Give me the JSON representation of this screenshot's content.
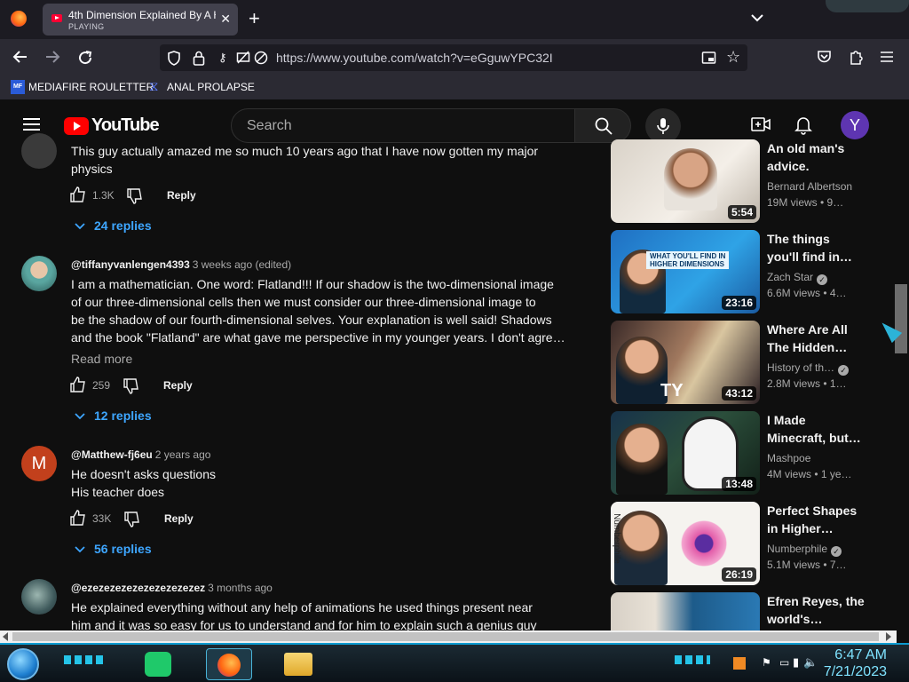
{
  "browser": {
    "tab": {
      "title": "4th Dimension Explained By A Hig",
      "status": "PLAYING",
      "close": "✕"
    },
    "new_tab": "+",
    "tab_list": "⌄",
    "url": "https://www.youtube.com/watch?v=eGguwYPC32I",
    "bookmarks": [
      {
        "label": "MEDIAFIRE ROULETTER",
        "icon": "MF"
      },
      {
        "label": "ANAL PROLAPSE",
        "icon": "⧖"
      }
    ]
  },
  "youtube": {
    "logo_text": "YouTube",
    "search_placeholder": "Search",
    "avatar_letter": "Y"
  },
  "comments": [
    {
      "text_lines": [
        "This guy actually amazed me so much 10 years ago that I have now gotten my major",
        "physics"
      ],
      "likes": "1.3K",
      "reply_label": "Reply",
      "replies": "24 replies"
    },
    {
      "user": "@tiffanyvanlengen4393",
      "time": "3 weeks ago (edited)",
      "text_lines": [
        "I am a mathematician. One word: Flatland!!! If our shadow is the two-dimensional image",
        "of our three-dimensional cells then we must consider our three-dimensional image to",
        "be the shadow of our fourth-dimensional selves. Your explanation is well said! Shadows",
        "and the book \"Flatland\" are what gave me perspective in my younger years. I don't agre…"
      ],
      "read_more": "Read more",
      "likes": "259",
      "reply_label": "Reply",
      "replies": "12 replies"
    },
    {
      "user": "@Matthew-fj6eu",
      "time": "2 years ago",
      "avatar_letter": "M",
      "text_lines": [
        "He doesn't asks questions",
        "His teacher does"
      ],
      "likes": "33K",
      "reply_label": "Reply",
      "replies": "56 replies"
    },
    {
      "user": "@ezezezezezezezezezezez",
      "time": "3 months ago",
      "text_lines": [
        "He explained everything without any help of animations he used things present near",
        "him and it was so easy for us to understand and for him to explain such a genius guy"
      ]
    }
  ],
  "sidebar": [
    {
      "title": "An old man's advice.",
      "channel": "Bernard Albertson",
      "verified": false,
      "meta": "19M views • 9…",
      "duration": "5:54"
    },
    {
      "title": "The things you'll find in…",
      "channel": "Zach Star",
      "verified": true,
      "meta": "6.6M views • 4…",
      "duration": "23:16",
      "thumb_text": [
        "WHAT YOU'LL FIND IN",
        "HIGHER DIMENSIONS"
      ]
    },
    {
      "title": "Where Are All The Hidden…",
      "channel": "History of th…",
      "verified": true,
      "meta": "2.8M views • 1…",
      "duration": "43:12",
      "thumb_text": [
        "TY"
      ]
    },
    {
      "title": "I Made Minecraft, but…",
      "channel": "Mashpoe",
      "verified": false,
      "meta": "4M views • 1 ye…",
      "duration": "13:48"
    },
    {
      "title": "Perfect Shapes in Higher…",
      "channel": "Numberphile",
      "verified": true,
      "meta": "5.1M views • 7…",
      "duration": "26:19",
      "thumb_text": [
        "Numberphile"
      ]
    },
    {
      "title": "Efren Reyes, the world's…"
    }
  ],
  "taskbar": {
    "time": "6:47 AM",
    "date": "7/21/2023"
  }
}
